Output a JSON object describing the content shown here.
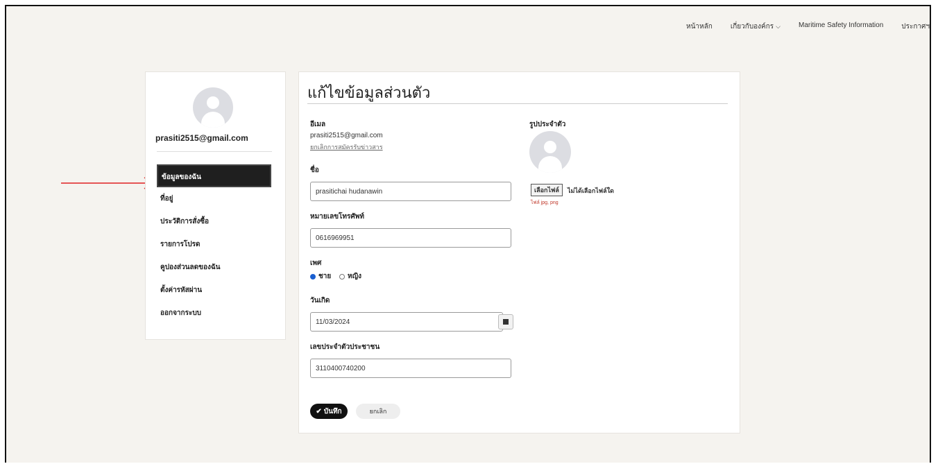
{
  "topnav": {
    "items": [
      "หน้าหลัก",
      "เกี่ยวกับองค์กร",
      "Maritime Safety Information",
      "ประกาศฯ"
    ]
  },
  "sidebar": {
    "email": "prasiti2515@gmail.com",
    "items": [
      {
        "label": "ข้อมูลของฉัน",
        "active": true
      },
      {
        "label": "ที่อยู่"
      },
      {
        "label": "ประวัติการสั่งซื้อ"
      },
      {
        "label": "รายการโปรด"
      },
      {
        "label": "คูปองส่วนลดของฉัน"
      },
      {
        "label": "ตั้งค่ารหัสผ่าน"
      },
      {
        "label": "ออกจากระบบ"
      }
    ]
  },
  "form": {
    "title": "แก้ไขข้อมูลส่วนตัว",
    "email_label": "อีเมล",
    "email_value": "prasiti2515@gmail.com",
    "unsubscribe_link": "ยกเลิกการสมัครรับข่าวสาร",
    "name_label": "ชื่อ",
    "name_value": "prasitichai hudanawin",
    "phone_label": "หมายเลขโทรศัพท์",
    "phone_value": "0616969951",
    "gender_label": "เพศ",
    "gender_options": [
      "ชาย",
      "หญิง"
    ],
    "gender_selected": "ชาย",
    "birthday_label": "วันเกิด",
    "birthday_value": "11/03/2024",
    "id_label": "เลขประจำตัวประชาชน",
    "id_value": "3110400740200",
    "save_label": "บันทึก",
    "cancel_label": "ยกเลิก",
    "photo_label": "รูปประจำตัว",
    "file_button": "เลือกไฟล์",
    "file_status": "ไม่ได้เลือกไฟล์ใด",
    "file_hint": "ไฟล์ jpg, png"
  },
  "colors": {
    "active_item_bg": "#1f1f1f",
    "arrow": "#e02020",
    "radio_selected": "#1a5fd0",
    "hint": "#c0392b"
  }
}
